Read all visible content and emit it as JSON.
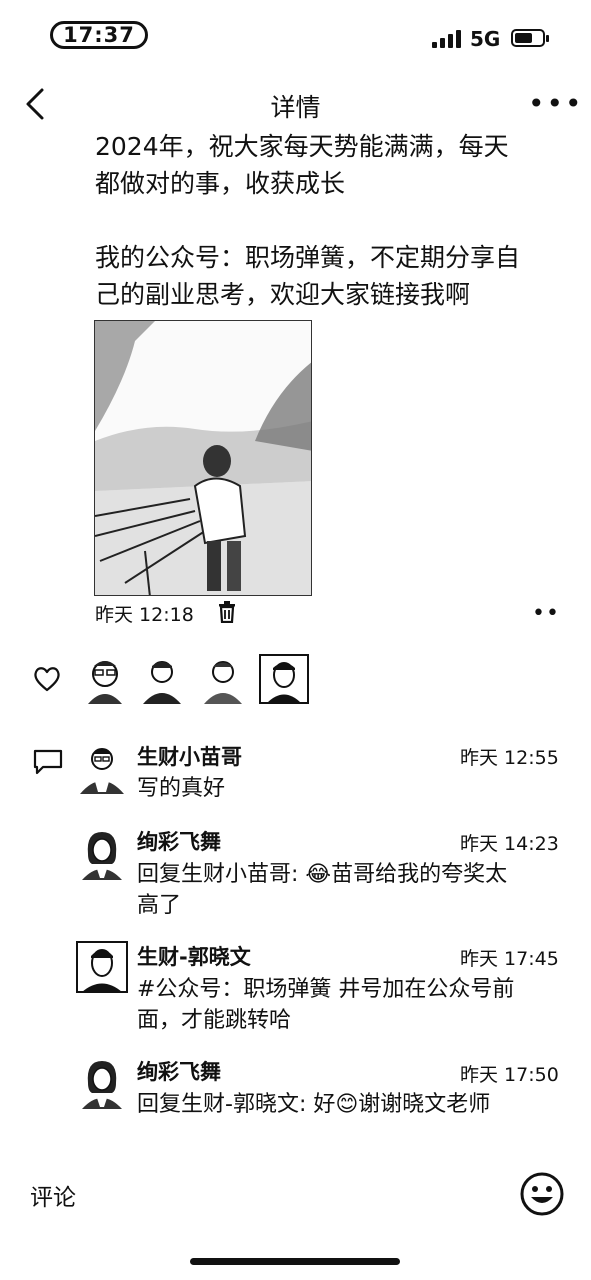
{
  "status_bar": {
    "time": "17:37",
    "network": "5G"
  },
  "nav": {
    "title": "详情"
  },
  "post": {
    "text": "2024年，祝大家每天势能满满，每天\n都做对的事，收获成长\n\n我的公众号：职场弹簧，不定期分享自\n己的副业思考，欢迎大家链接我啊",
    "time": "昨天 12:18"
  },
  "comments": [
    {
      "name": "生财小苗哥",
      "time": "昨天 12:55",
      "text": "写的真好"
    },
    {
      "name": "绚彩飞舞",
      "time": "昨天 14:23",
      "text": "回复生财小苗哥: 😂苗哥给我的夸奖太\n高了"
    },
    {
      "name": "生财-郭晓文",
      "time": "昨天 17:45",
      "text": "#公众号：职场弹簧 井号加在公众号前\n面，才能跳转哈"
    },
    {
      "name": "绚彩飞舞",
      "time": "昨天 17:50",
      "text": "回复生财-郭晓文: 好😊谢谢晓文老师"
    }
  ],
  "bottom": {
    "comment_placeholder": "评论"
  },
  "icons": [
    "back-icon",
    "more-icon",
    "trash-icon",
    "heart-icon",
    "comment-icon",
    "emoji-icon"
  ]
}
